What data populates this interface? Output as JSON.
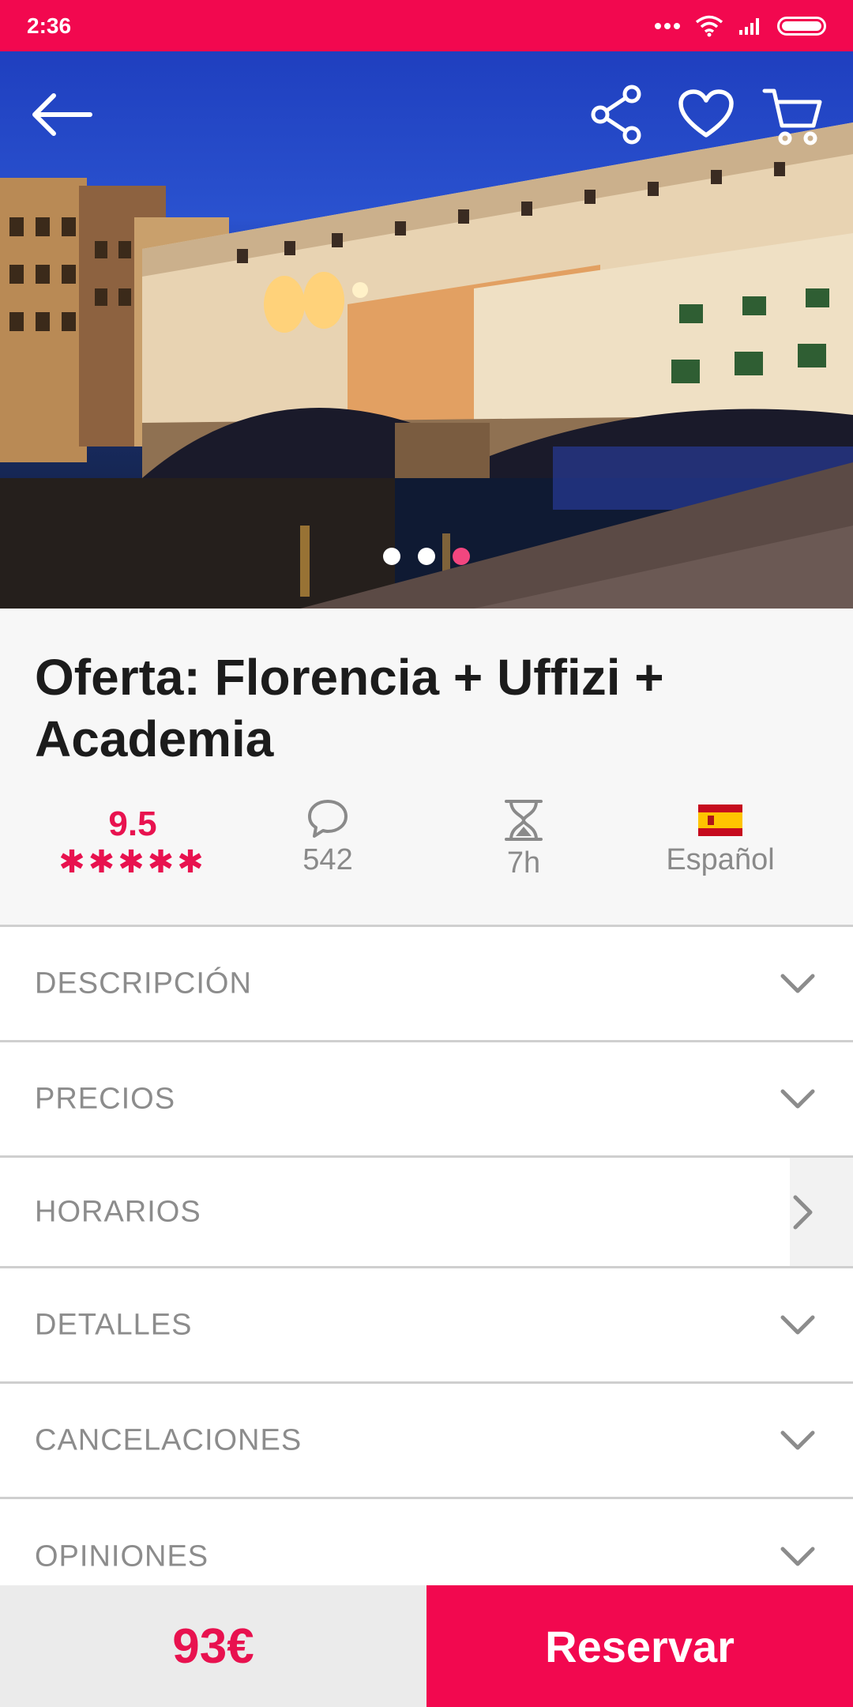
{
  "status_bar": {
    "time": "2:36"
  },
  "hero": {
    "slide_count": 3,
    "active_slide": 3
  },
  "title": "Oferta: Florencia + Uffizi + Academia",
  "stats": {
    "rating": "9.5",
    "stars_display": "✱✱✱✱✱",
    "reviews": "542",
    "duration": "7h",
    "language": "Español"
  },
  "sections": [
    {
      "label": "DESCRIPCIÓN",
      "indicator": "chevron-down-icon"
    },
    {
      "label": "PRECIOS",
      "indicator": "chevron-down-icon"
    },
    {
      "label": "HORARIOS",
      "indicator": "chevron-right-icon"
    },
    {
      "label": "DETALLES",
      "indicator": "chevron-down-icon"
    },
    {
      "label": "CANCELACIONES",
      "indicator": "chevron-down-icon"
    },
    {
      "label": "OPINIONES",
      "indicator": "chevron-down-icon"
    }
  ],
  "bottom_bar": {
    "price": "93€",
    "book_label": "Reservar"
  },
  "colors": {
    "brand": "#f2084f",
    "accent_text": "#e8124f"
  }
}
